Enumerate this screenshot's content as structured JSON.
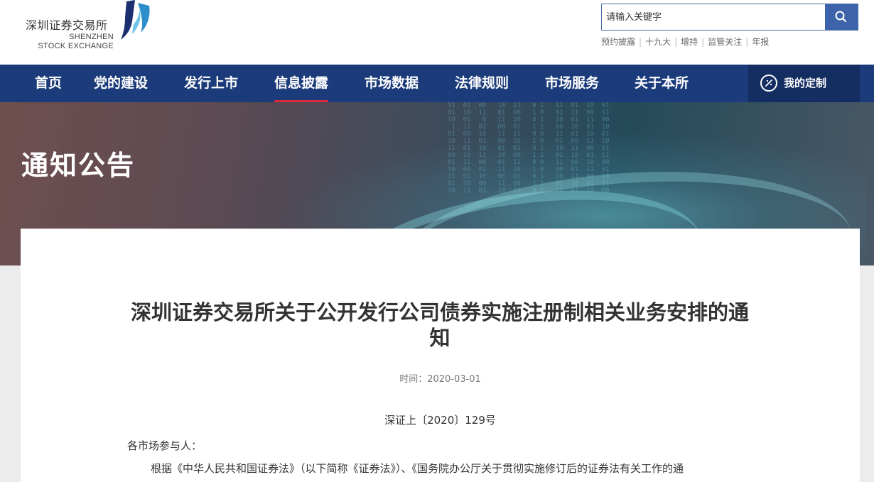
{
  "header": {
    "logo_cn": "深圳证券交易所",
    "logo_en_line1": "SHENZHEN",
    "logo_en_line2": "STOCK EXCHANGE",
    "search_placeholder": "请输入关键字",
    "quick_links": [
      "预约披露",
      "十九大",
      "增持",
      "监管关注",
      "年报"
    ]
  },
  "nav": {
    "items": [
      "首页",
      "党的建设",
      "发行上市",
      "信息披露",
      "市场数据",
      "法律规则",
      "市场服务",
      "关于本所"
    ],
    "active": "信息披露",
    "custom_label": "我的定制"
  },
  "banner": {
    "title": "通知公告"
  },
  "article": {
    "title": "深圳证券交易所关于公开发行公司债券实施注册制相关业务安排的通知",
    "date": "时间：2020-03-01",
    "doc_number": "深证上〔2020〕129号",
    "salutation": "各市场参与人：",
    "paragraph": "根据《中华人民共和国证券法》（以下简称《证券法》）、《国务院办公厅关于贯彻实施修订后的证券法有关工作的通"
  },
  "colors": {
    "nav_bg": "#1b3b7a",
    "nav_custom_bg": "#142e62",
    "active_underline": "#d9293a",
    "search_button": "#3d63aa"
  },
  "icons": {
    "search": "search-icon",
    "custom": "customize-icon",
    "logo": "szse-logo-icon"
  }
}
